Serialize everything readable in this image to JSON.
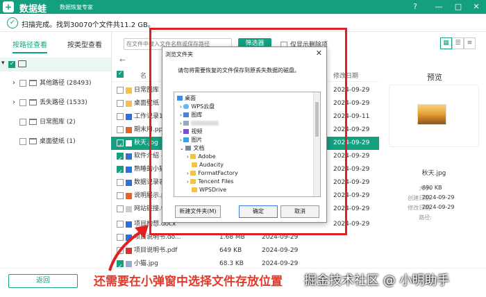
{
  "app": {
    "name": "数据蛙",
    "subtitle": "数据恢复专家",
    "logo_glyph": "+"
  },
  "window_controls": {
    "help": "?",
    "min": "—",
    "max": "□",
    "close": "✕"
  },
  "status": {
    "text": "扫描完成。找到30070个文件共11.2 GB。"
  },
  "sidebar": {
    "tabs": [
      {
        "label": "按路径查看"
      },
      {
        "label": "按类型查看"
      }
    ],
    "items": [
      {
        "label": "其他路径 (28493)"
      },
      {
        "label": "丢失路径 (1533)"
      },
      {
        "label": "日常图库 (2)"
      },
      {
        "label": "桌面壁纸 (1)"
      }
    ]
  },
  "toolbar": {
    "search_placeholder": "在文件中搜入文件名称或保存路径",
    "filter_label": "筛选器",
    "only_deleted_label": "仅显示删除项"
  },
  "list": {
    "col_name": "名",
    "col_date": "修改日期",
    "rows": [
      {
        "name": "日常图库",
        "size": "",
        "date": "2024-09-29"
      },
      {
        "name": "桌面壁纸",
        "size": "",
        "date": "2024-09-29"
      },
      {
        "name": "工作记录1",
        "size": "",
        "date": "2024-09-11"
      },
      {
        "name": "期末用.ppt",
        "size": "",
        "date": "2024-09-29"
      },
      {
        "name": "秋天.jpg",
        "size": "",
        "date": "2024-09-29"
      },
      {
        "name": "软件介绍 -",
        "size": "",
        "date": "2024-09-29"
      },
      {
        "name": "熟睡的小猫",
        "size": "",
        "date": "2024-09-29"
      },
      {
        "name": "数据记录表",
        "size": "",
        "date": "2024-09-29"
      },
      {
        "name": "说明展示.p",
        "size": "",
        "date": "2024-09-29"
      },
      {
        "name": "网站链接.t",
        "size": "",
        "date": "2024-09-29"
      },
      {
        "name": "项目构想.docx",
        "size": "",
        "date": "2024-09-29"
      },
      {
        "name": "项目说明书.do...",
        "size": "1.68 MB",
        "date": "2024-09-29"
      },
      {
        "name": "项目说明书.pdf",
        "size": "649 KB",
        "date": "2024-09-29"
      },
      {
        "name": "小猫.jpg",
        "size": "68.3 KB",
        "date": "2024-09-29"
      }
    ]
  },
  "preview": {
    "title": "预览",
    "filename": "秋天.jpg",
    "size_label": "大小:",
    "size_value": "890 KB",
    "created_label": "创建日期:",
    "created_value": "2024-09-29",
    "modified_label": "修改日期:",
    "modified_value": "2024-09-29",
    "path_label": "路径:"
  },
  "dialog": {
    "title": "浏览文件夹",
    "message": "请勿将需要恢复的文件保存到原丢失数据的磁盘。",
    "tree": [
      {
        "label": "桌面"
      },
      {
        "label": "WPS云盘"
      },
      {
        "label": "图库"
      },
      {
        "label": ""
      },
      {
        "label": "视频"
      },
      {
        "label": "图片"
      },
      {
        "label": "文档"
      },
      {
        "label": "Adobe"
      },
      {
        "label": "Audacity"
      },
      {
        "label": "FormatFactory"
      },
      {
        "label": "Tencent Files"
      },
      {
        "label": "WPSDrive"
      }
    ],
    "new_folder_label": "新建文件夹(M)",
    "ok_label": "确定",
    "cancel_label": "取消",
    "close": "✕"
  },
  "bottom": {
    "back_label": "返回",
    "caption": "还需要在小弹窗中选择文件存放位置",
    "watermark": "掘金技术社区 @ 小明助手"
  },
  "colors": {
    "accent": "#14a07f",
    "annotation": "#e02020"
  }
}
